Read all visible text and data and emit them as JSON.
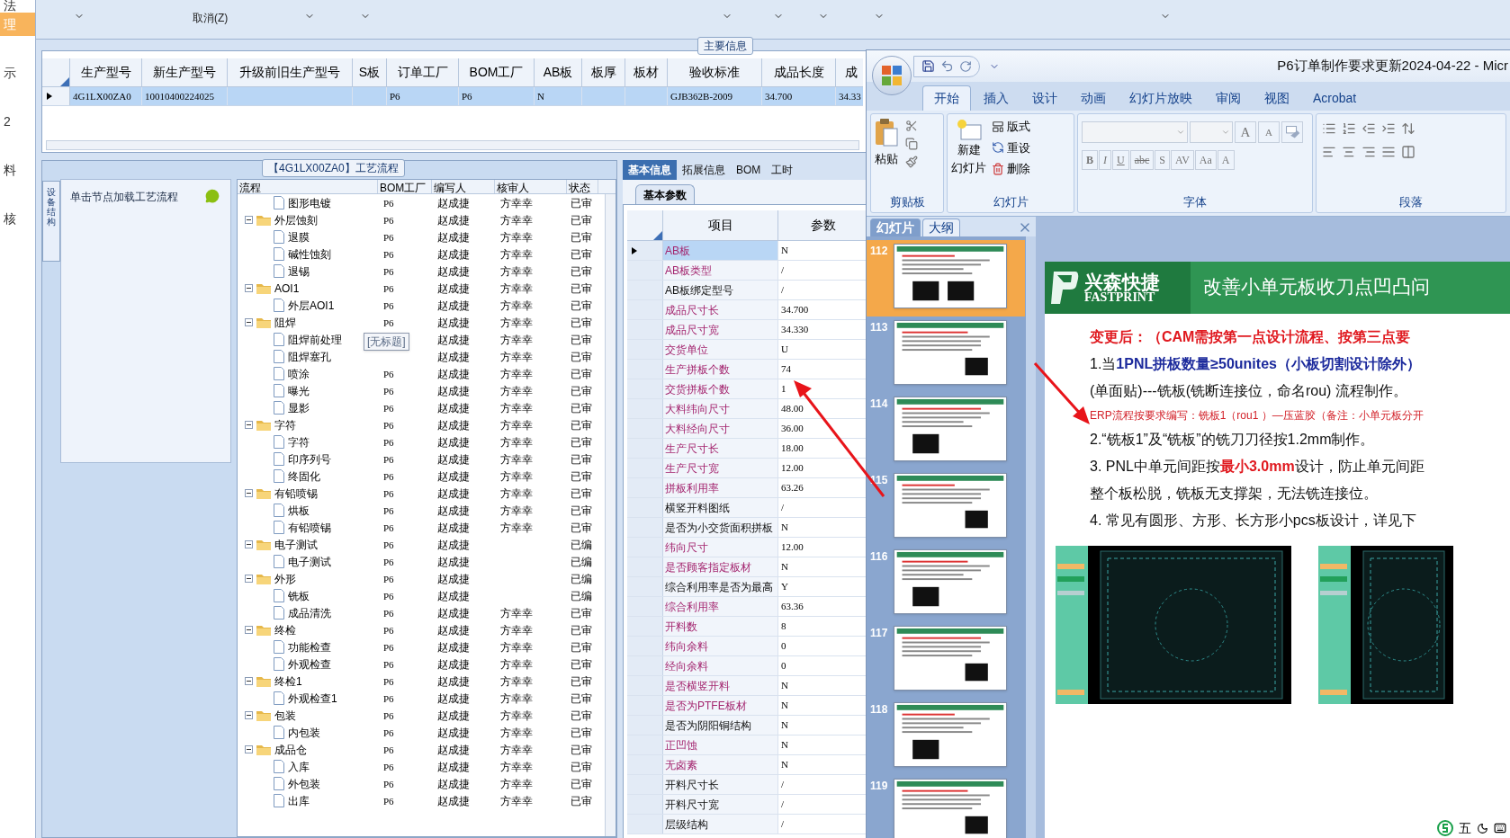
{
  "sidebar": {
    "items": [
      {
        "label": "法",
        "selected": false
      },
      {
        "label": "理",
        "selected": true
      },
      {
        "label": "示",
        "selected": false
      },
      {
        "label": "2",
        "selected": false
      },
      {
        "label": "料",
        "selected": false
      },
      {
        "label": "核",
        "selected": false
      }
    ]
  },
  "toolbar": {
    "cancel_label": "取消(Z)"
  },
  "main_info": {
    "title": "主要信息",
    "columns": [
      "生产型号",
      "新生产型号",
      "升级前旧生产型号",
      "S板",
      "订单工厂",
      "BOM工厂",
      "AB板",
      "板厚",
      "板材",
      "验收标准",
      "成品长度",
      "成"
    ],
    "rows": [
      {
        "selected": true,
        "cells": [
          "4G1LX00ZA0",
          "10010400224025",
          "",
          "",
          "P6",
          "P6",
          "N",
          "",
          "",
          "GJB362B-2009",
          "34.700",
          "34.33"
        ]
      }
    ]
  },
  "process": {
    "title": "【4G1LX00ZA0】工艺流程",
    "side_tab": "设备结构",
    "node_hint": "单击节点加载工艺流程",
    "tooltip": "[无标题]",
    "columns": [
      "流程",
      "BOM工厂",
      "编写人",
      "核审人",
      "状态"
    ],
    "tree": [
      {
        "name": "图形电镀",
        "bom": "P6",
        "author": "赵成捷",
        "reviewer": "方幸幸",
        "status": "已审"
      },
      {
        "name": "外层蚀刻",
        "bom": "P6",
        "author": "赵成捷",
        "reviewer": "方幸幸",
        "status": "已审",
        "expanded": true,
        "children": [
          {
            "name": "退膜",
            "bom": "P6",
            "author": "赵成捷",
            "reviewer": "方幸幸",
            "status": "已审"
          },
          {
            "name": "碱性蚀刻",
            "bom": "P6",
            "author": "赵成捷",
            "reviewer": "方幸幸",
            "status": "已审"
          },
          {
            "name": "退锡",
            "bom": "P6",
            "author": "赵成捷",
            "reviewer": "方幸幸",
            "status": "已审"
          }
        ]
      },
      {
        "name": "AOI1",
        "bom": "P6",
        "author": "赵成捷",
        "reviewer": "方幸幸",
        "status": "已审",
        "expanded": true,
        "children": [
          {
            "name": "外层AOI1",
            "bom": "P6",
            "author": "赵成捷",
            "reviewer": "方幸幸",
            "status": "已审"
          }
        ]
      },
      {
        "name": "阻焊",
        "bom": "P6",
        "author": "赵成捷",
        "reviewer": "方幸幸",
        "status": "已审",
        "expanded": true,
        "children": [
          {
            "name": "阻焊前处理",
            "author": "赵成捷",
            "reviewer": "方幸幸",
            "status": "已审"
          },
          {
            "name": "阻焊塞孔",
            "author": "赵成捷",
            "reviewer": "方幸幸",
            "status": "已审"
          },
          {
            "name": "喷涂",
            "bom": "P6",
            "author": "赵成捷",
            "reviewer": "方幸幸",
            "status": "已审"
          },
          {
            "name": "曝光",
            "bom": "P6",
            "author": "赵成捷",
            "reviewer": "方幸幸",
            "status": "已审"
          },
          {
            "name": "显影",
            "bom": "P6",
            "author": "赵成捷",
            "reviewer": "方幸幸",
            "status": "已审"
          }
        ]
      },
      {
        "name": "字符",
        "bom": "P6",
        "author": "赵成捷",
        "reviewer": "方幸幸",
        "status": "已审",
        "expanded": true,
        "children": [
          {
            "name": "字符",
            "bom": "P6",
            "author": "赵成捷",
            "reviewer": "方幸幸",
            "status": "已审"
          },
          {
            "name": "印序列号",
            "bom": "P6",
            "author": "赵成捷",
            "reviewer": "方幸幸",
            "status": "已审"
          },
          {
            "name": "终固化",
            "bom": "P6",
            "author": "赵成捷",
            "reviewer": "方幸幸",
            "status": "已审"
          }
        ]
      },
      {
        "name": "有铅喷锡",
        "bom": "P6",
        "author": "赵成捷",
        "reviewer": "方幸幸",
        "status": "已审",
        "expanded": true,
        "children": [
          {
            "name": "烘板",
            "bom": "P6",
            "author": "赵成捷",
            "reviewer": "方幸幸",
            "status": "已审"
          },
          {
            "name": "有铅喷锡",
            "bom": "P6",
            "author": "赵成捷",
            "reviewer": "方幸幸",
            "status": "已审"
          }
        ]
      },
      {
        "name": "电子测试",
        "bom": "P6",
        "author": "赵成捷",
        "status": "已编",
        "expanded": true,
        "children": [
          {
            "name": "电子测试",
            "bom": "P6",
            "author": "赵成捷",
            "status": "已编"
          }
        ]
      },
      {
        "name": "外形",
        "bom": "P6",
        "author": "赵成捷",
        "status": "已编",
        "expanded": true,
        "children": [
          {
            "name": "铣板",
            "bom": "P6",
            "author": "赵成捷",
            "status": "已编"
          },
          {
            "name": "成品清洗",
            "bom": "P6",
            "author": "赵成捷",
            "reviewer": "方幸幸",
            "status": "已审"
          }
        ]
      },
      {
        "name": "终检",
        "bom": "P6",
        "author": "赵成捷",
        "reviewer": "方幸幸",
        "status": "已审",
        "expanded": true,
        "children": [
          {
            "name": "功能检查",
            "bom": "P6",
            "author": "赵成捷",
            "reviewer": "方幸幸",
            "status": "已审"
          },
          {
            "name": "外观检查",
            "bom": "P6",
            "author": "赵成捷",
            "reviewer": "方幸幸",
            "status": "已审"
          }
        ]
      },
      {
        "name": "终检1",
        "bom": "P6",
        "author": "赵成捷",
        "reviewer": "方幸幸",
        "status": "已审",
        "expanded": true,
        "children": [
          {
            "name": "外观检查1",
            "bom": "P6",
            "author": "赵成捷",
            "reviewer": "方幸幸",
            "status": "已审"
          }
        ]
      },
      {
        "name": "包装",
        "bom": "P6",
        "author": "赵成捷",
        "reviewer": "方幸幸",
        "status": "已审",
        "expanded": true,
        "children": [
          {
            "name": "内包装",
            "bom": "P6",
            "author": "赵成捷",
            "reviewer": "方幸幸",
            "status": "已审"
          }
        ]
      },
      {
        "name": "成品仓",
        "bom": "P6",
        "author": "赵成捷",
        "reviewer": "方幸幸",
        "status": "已审",
        "expanded": true,
        "children": [
          {
            "name": "入库",
            "bom": "P6",
            "author": "赵成捷",
            "reviewer": "方幸幸",
            "status": "已审"
          },
          {
            "name": "外包装",
            "bom": "P6",
            "author": "赵成捷",
            "reviewer": "方幸幸",
            "status": "已审"
          },
          {
            "name": "出库",
            "bom": "P6",
            "author": "赵成捷",
            "reviewer": "方幸幸",
            "status": "已审"
          }
        ]
      }
    ]
  },
  "params": {
    "tabs": [
      {
        "label": "基本信息",
        "selected": true
      },
      {
        "label": "拓展信息",
        "selected": false
      },
      {
        "label": "BOM",
        "selected": false
      },
      {
        "label": "工时",
        "selected": false
      }
    ],
    "subtab": "基本参数",
    "columns": [
      "项目",
      "参数"
    ],
    "rows": [
      {
        "label": "AB板",
        "value": "N",
        "required": true,
        "selected": true
      },
      {
        "label": "AB板类型",
        "value": "/",
        "required": true,
        "selected": false
      },
      {
        "label": "AB板绑定型号",
        "value": "/",
        "required": false,
        "selected": false
      },
      {
        "label": "成品尺寸长",
        "value": "34.700",
        "required": true,
        "selected": false
      },
      {
        "label": "成品尺寸宽",
        "value": "34.330",
        "required": true,
        "selected": false
      },
      {
        "label": "交货单位",
        "value": "U",
        "required": true,
        "selected": false
      },
      {
        "label": "生产拼板个数",
        "value": "74",
        "required": true,
        "selected": false
      },
      {
        "label": "交货拼板个数",
        "value": "1",
        "required": true,
        "selected": false
      },
      {
        "label": "大料纬向尺寸",
        "value": "48.00",
        "required": true,
        "selected": false
      },
      {
        "label": "大料经向尺寸",
        "value": "36.00",
        "required": true,
        "selected": false
      },
      {
        "label": "生产尺寸长",
        "value": "18.00",
        "required": true,
        "selected": false
      },
      {
        "label": "生产尺寸宽",
        "value": "12.00",
        "required": true,
        "selected": false
      },
      {
        "label": "拼板利用率",
        "value": "63.26",
        "required": true,
        "selected": false
      },
      {
        "label": "横竖开料图纸",
        "value": "/",
        "required": false,
        "selected": false
      },
      {
        "label": "是否为小交货面积拼板",
        "value": "N",
        "required": false,
        "selected": false
      },
      {
        "label": "纬向尺寸",
        "value": "12.00",
        "required": true,
        "selected": false
      },
      {
        "label": "是否顾客指定板材",
        "value": "N",
        "required": true,
        "selected": false
      },
      {
        "label": "综合利用率是否为最高",
        "value": "Y",
        "required": false,
        "selected": false
      },
      {
        "label": "综合利用率",
        "value": "63.36",
        "required": true,
        "selected": false
      },
      {
        "label": "开料数",
        "value": "8",
        "required": true,
        "selected": false
      },
      {
        "label": "纬向余料",
        "value": "0",
        "required": true,
        "selected": false
      },
      {
        "label": "经向余料",
        "value": "0",
        "required": true,
        "selected": false
      },
      {
        "label": "是否横竖开料",
        "value": "N",
        "required": true,
        "selected": false
      },
      {
        "label": "是否为PTFE板材",
        "value": "N",
        "required": true,
        "selected": false
      },
      {
        "label": "是否为阴阳铜结构",
        "value": "N",
        "required": false,
        "selected": false
      },
      {
        "label": "正凹蚀",
        "value": "N",
        "required": true,
        "selected": false
      },
      {
        "label": "无卤素",
        "value": "N",
        "required": true,
        "selected": false
      },
      {
        "label": "开料尺寸长",
        "value": "/",
        "required": false,
        "selected": false
      },
      {
        "label": "开料尺寸宽",
        "value": "/",
        "required": false,
        "selected": false
      },
      {
        "label": "层级结构",
        "value": "/",
        "required": false,
        "selected": false
      }
    ]
  },
  "ppt": {
    "title": "P6订单制作要求更新2024-04-22 - Micr",
    "tabs": [
      {
        "label": "开始",
        "selected": true
      },
      {
        "label": "插入",
        "selected": false
      },
      {
        "label": "设计",
        "selected": false
      },
      {
        "label": "动画",
        "selected": false
      },
      {
        "label": "幻灯片放映",
        "selected": false
      },
      {
        "label": "审阅",
        "selected": false
      },
      {
        "label": "视图",
        "selected": false
      },
      {
        "label": "Acrobat",
        "selected": false
      }
    ],
    "clipboard": {
      "label": "剪贴板",
      "paste": "粘贴"
    },
    "slides_group": {
      "label": "幻灯片",
      "new_slide_1": "新建",
      "new_slide_2": "幻灯片",
      "layout": "版式",
      "reset": "重设",
      "delete": "删除"
    },
    "font_group": {
      "label": "字体",
      "size_buttons": [
        "A",
        "A"
      ],
      "buttons": [
        "B",
        "I",
        "U",
        "abc",
        "S",
        "AV",
        "Aa",
        "A"
      ]
    },
    "paragraph_group": {
      "label": "段落"
    },
    "pane_tabs": [
      {
        "label": "幻灯片",
        "selected": true
      },
      {
        "label": "大纲",
        "selected": false
      }
    ],
    "thumbnails": [
      {
        "number": "112",
        "selected": true
      },
      {
        "number": "113",
        "selected": false
      },
      {
        "number": "114",
        "selected": false
      },
      {
        "number": "115",
        "selected": false
      },
      {
        "number": "116",
        "selected": false
      },
      {
        "number": "117",
        "selected": false
      },
      {
        "number": "118",
        "selected": false
      },
      {
        "number": "119",
        "selected": false
      }
    ],
    "slide": {
      "brand_cn": "兴森快捷",
      "brand_en": "FASTPRINT",
      "title": "改善小单元板收刀点凹凸问",
      "lines": [
        {
          "kind": "heading",
          "text": "变更后：（CAM需按第一点设计流程、按第三点要"
        },
        {
          "kind": "body",
          "segments": [
            {
              "text": "1.当"
            },
            {
              "text": "1PNL拼板数量≥50unites（小板切割设计除外）",
              "color": "#1c2a9c"
            }
          ]
        },
        {
          "kind": "body",
          "text": "(单面贴)---铣板(铣断连接位，命名rou) 流程制作。"
        },
        {
          "kind": "note",
          "text": "ERP流程按要求编写：铣板1（rou1 ）—压蓝胶（备注：小单元板分开"
        },
        {
          "kind": "body",
          "text": "2.“铣板1”及“铣板”的铣刀刀径按1.2mm制作。"
        },
        {
          "kind": "body",
          "segments": [
            {
              "text": "3. PNL中单元间距按"
            },
            {
              "text": "最小3.0mm",
              "color": "#e0191f"
            },
            {
              "text": "设计，防止单元间距"
            }
          ]
        },
        {
          "kind": "body",
          "text": "整个板松脱，铣板无支撑架，无法铣连接位。"
        },
        {
          "kind": "body",
          "text": "4. 常见有圆形、方形、长方形小pcs板设计，详见下"
        }
      ]
    },
    "ime": {
      "label": "五"
    }
  }
}
